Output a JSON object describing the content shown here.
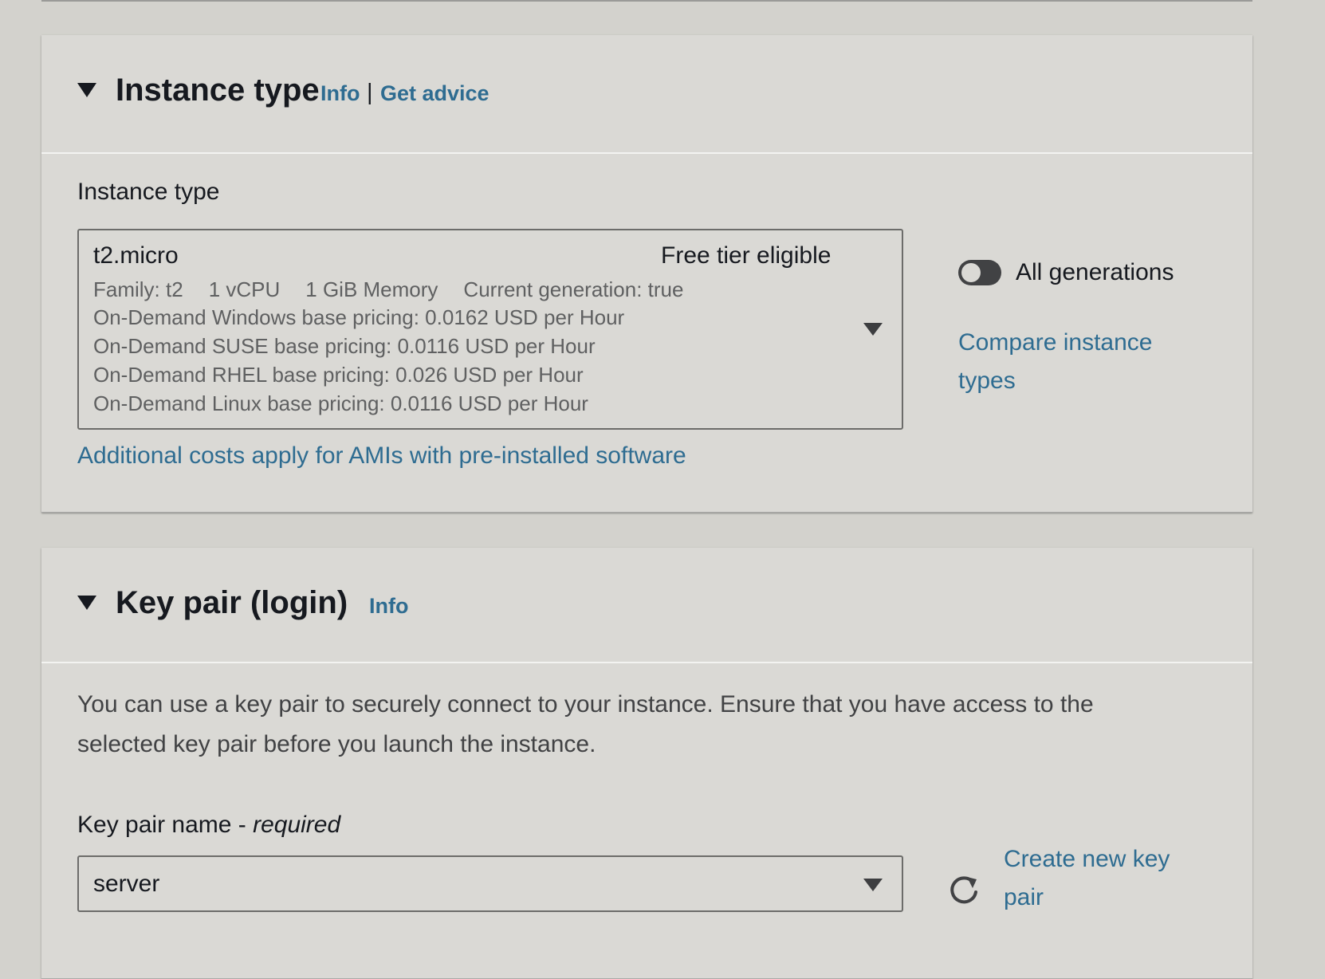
{
  "instance_type_panel": {
    "title": "Instance type",
    "info_link": "Info",
    "separator": "|",
    "advice_link": "Get advice",
    "field_label": "Instance type",
    "selected": {
      "name": "t2.micro",
      "badge": "Free tier eligible",
      "family": "Family: t2",
      "vcpu": "1 vCPU",
      "memory": "1 GiB Memory",
      "generation": "Current generation: true",
      "pricing": [
        "On-Demand Windows base pricing: 0.0162 USD per Hour",
        "On-Demand SUSE base pricing: 0.0116 USD per Hour",
        "On-Demand RHEL base pricing: 0.026 USD per Hour",
        "On-Demand Linux base pricing: 0.0116 USD per Hour"
      ]
    },
    "additional_costs_link": "Additional costs apply for AMIs with pre-installed software",
    "toggle_label": "All generations",
    "toggle_on": false,
    "compare_link_line1": "Compare instance",
    "compare_link_line2": "types"
  },
  "key_pair_panel": {
    "title": "Key pair (login)",
    "info_link": "Info",
    "description": "You can use a key pair to securely connect to your instance. Ensure that you have access to the selected key pair before you launch the instance.",
    "field_label": "Key pair name - ",
    "field_required": "required",
    "selected_value": "server",
    "create_link_line1": "Create new key",
    "create_link_line2": "pair"
  },
  "colors": {
    "link": "#2e6c91",
    "text": "#16191f",
    "panel_bg": "#dad9d5",
    "page_bg": "#d3d2cd"
  },
  "icons": {
    "section_caret": "caret-down-icon",
    "select_caret": "caret-down-icon",
    "refresh": "refresh-icon"
  }
}
